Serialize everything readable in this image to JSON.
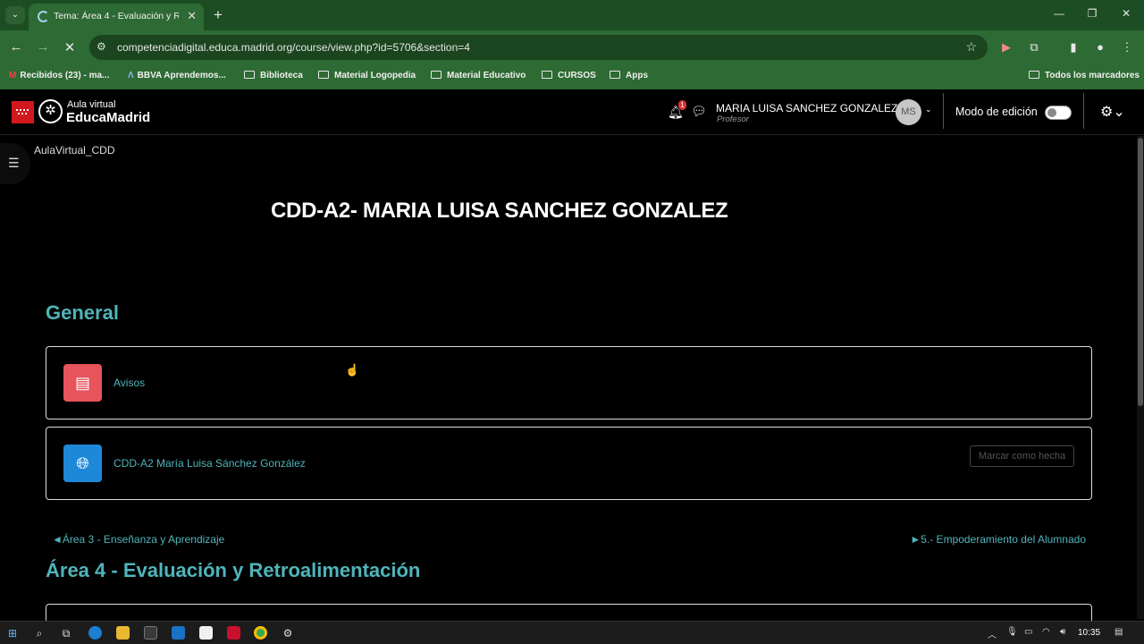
{
  "browser": {
    "tab_title": "Tema: Área 4 - Evaluación y Re",
    "tab_close": "✕",
    "new_tab": "+",
    "url": "competenciadigital.educa.madrid.org/course/view.php?id=5706&section=4",
    "bookmarks": [
      {
        "label": "Recibidos (23) - ma..."
      },
      {
        "label": "BBVA Aprendemos..."
      },
      {
        "label": "Biblioteca"
      },
      {
        "label": "Material Logopedia"
      },
      {
        "label": "Material Educativo"
      },
      {
        "label": "CURSOS"
      },
      {
        "label": "Apps"
      }
    ],
    "all_bookmarks": "Todos los marcadores"
  },
  "navbar": {
    "logo_top": "Aula virtual",
    "logo_main": "EducaMadrid",
    "notification_count": "1",
    "user_name": "MARIA LUISA SANCHEZ GONZALEZ",
    "user_role": "Profesor",
    "avatar_initials": "MS",
    "edit_mode_label": "Modo de edición"
  },
  "page": {
    "breadcrumb": "AulaVirtual_CDD",
    "course_title": "CDD-A2- MARIA LUISA SANCHEZ GONZALEZ",
    "section_general": "General",
    "activities": [
      {
        "label": "Avisos",
        "icon": "forum-icon",
        "color": "#e8545c"
      },
      {
        "label": "CDD-A2 María Luisa Sánchez González",
        "icon": "globe-icon",
        "color": "#1e88d8",
        "button": "Marcar como hecha"
      }
    ],
    "prev_link": "◄Área 3 - Enseñanza y Aprendizaje",
    "next_link": "►5.- Empoderamiento del Alumnado",
    "section_current": "Área 4 - Evaluación y Retroalimentación"
  },
  "taskbar": {
    "time": "10:35"
  },
  "colors": {
    "chrome_green": "#2e6a33",
    "accent_teal": "#4fb5bb"
  }
}
